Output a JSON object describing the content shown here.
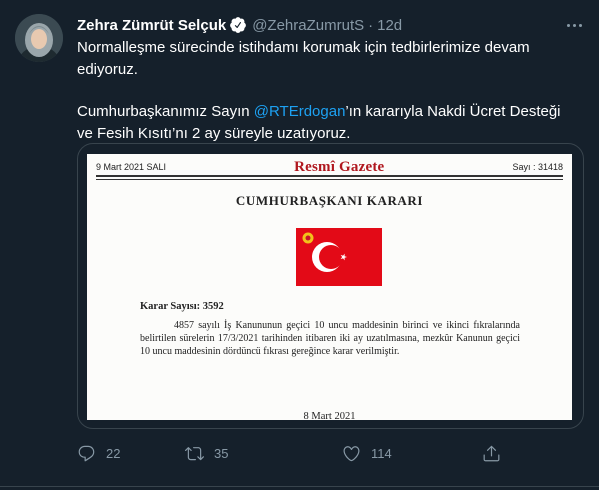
{
  "author": {
    "name": "Zehra Zümrüt Selçuk",
    "handle": "@ZehraZumrutS",
    "separator": "·",
    "time": "12d",
    "verified": true
  },
  "tweet": {
    "line1": "Normalleşme sürecinde istihdamı korumak için tedbirlerimize devam ediyoruz.",
    "line2_prefix": "Cumhurbaşkanımız Sayın ",
    "mention": "@RTErdogan",
    "line2_suffix": "’ın kararıyla Nakdi Ücret Desteği ve Fesih Kısıtı’nı 2 ay süreyle uzatıyoruz."
  },
  "document": {
    "date_left": "9 Mart 2021 SALI",
    "brand": "Resmî Gazete",
    "issue": "Sayı : 31418",
    "title": "CUMHURBAŞKANI KARARI",
    "decision_no": "Karar Sayısı: 3592",
    "body": "4857 sayılı İş Kanununun geçici 10 uncu maddesinin birinci ve ikinci fıkralarında belirtilen sürelerin 17/3/2021 tarihinden itibaren iki ay uzatılmasına, mezkûr Kanunun geçici 10 uncu maddesinin dördüncü fıkrası gereğince karar verilmiştir.",
    "signed_date": "8 Mart 2021"
  },
  "actions": {
    "reply_count": "22",
    "retweet_count": "35",
    "like_count": "114"
  },
  "colors": {
    "background": "#15202b",
    "accent": "#1da1f2",
    "muted": "#8899a6",
    "flag_red": "#e30a17"
  },
  "icons": [
    "verified-badge-icon",
    "more-icon",
    "reply-icon",
    "retweet-icon",
    "like-icon",
    "share-icon"
  ]
}
